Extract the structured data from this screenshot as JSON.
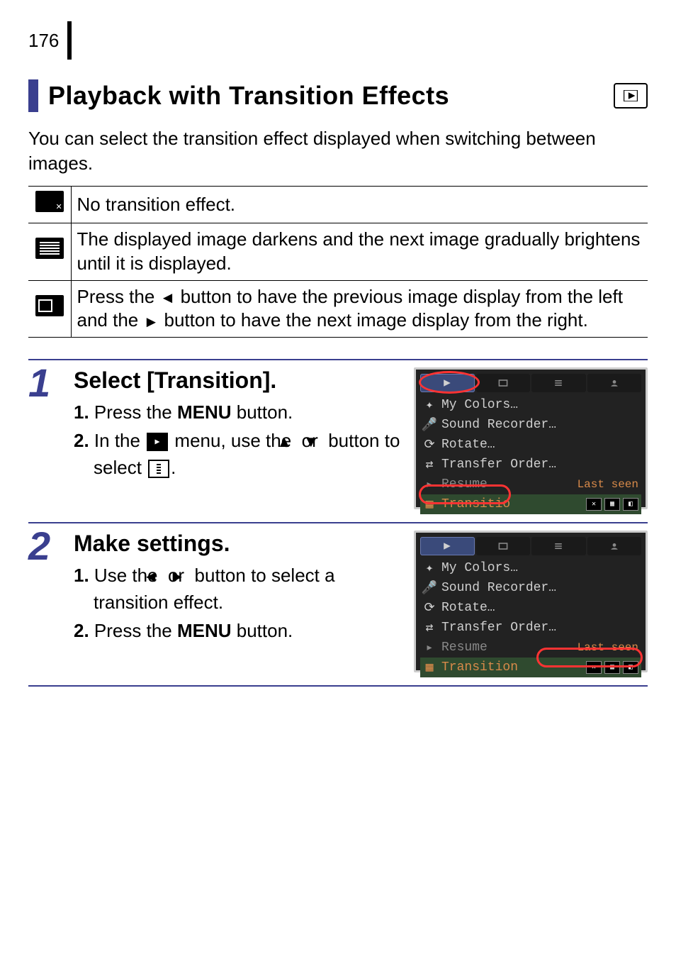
{
  "page_number": "176",
  "title": "Playback with Transition Effects",
  "intro": "You can select the transition effect displayed when switching between images.",
  "effects": {
    "none": "No transition effect.",
    "dissolve": "The displayed image darkens and the next image gradually brightens until it is displayed.",
    "slide_pre": "Press the ",
    "slide_mid": " button to have the previous image display from the left and the ",
    "slide_post": " button to have the next image display from the right."
  },
  "steps": {
    "s1": {
      "num": "1",
      "title": "Select [Transition].",
      "a_num": "1.",
      "a_pre": " Press the ",
      "a_bold": "MENU",
      "a_post": " button.",
      "b_num": "2.",
      "b_pre": " In the ",
      "b_mid1": " menu, use the ",
      "b_mid2": " or ",
      "b_mid3": " button to select ",
      "b_post": "."
    },
    "s2": {
      "num": "2",
      "title": "Make settings.",
      "a_num": "1.",
      "a_pre": " Use the ",
      "a_mid1": " or ",
      "a_mid2": " button to select a transition effect.",
      "b_num": "2.",
      "b_pre": " Press the ",
      "b_bold": "MENU",
      "b_post": " button."
    }
  },
  "menu": {
    "my_colors": "My Colors…",
    "sound_rec": "Sound Recorder…",
    "rotate": "Rotate…",
    "transfer": "Transfer Order…",
    "resume": "Resume",
    "resume_val": "Last seen",
    "transition_short": "Transitio",
    "transition": "Transition"
  }
}
